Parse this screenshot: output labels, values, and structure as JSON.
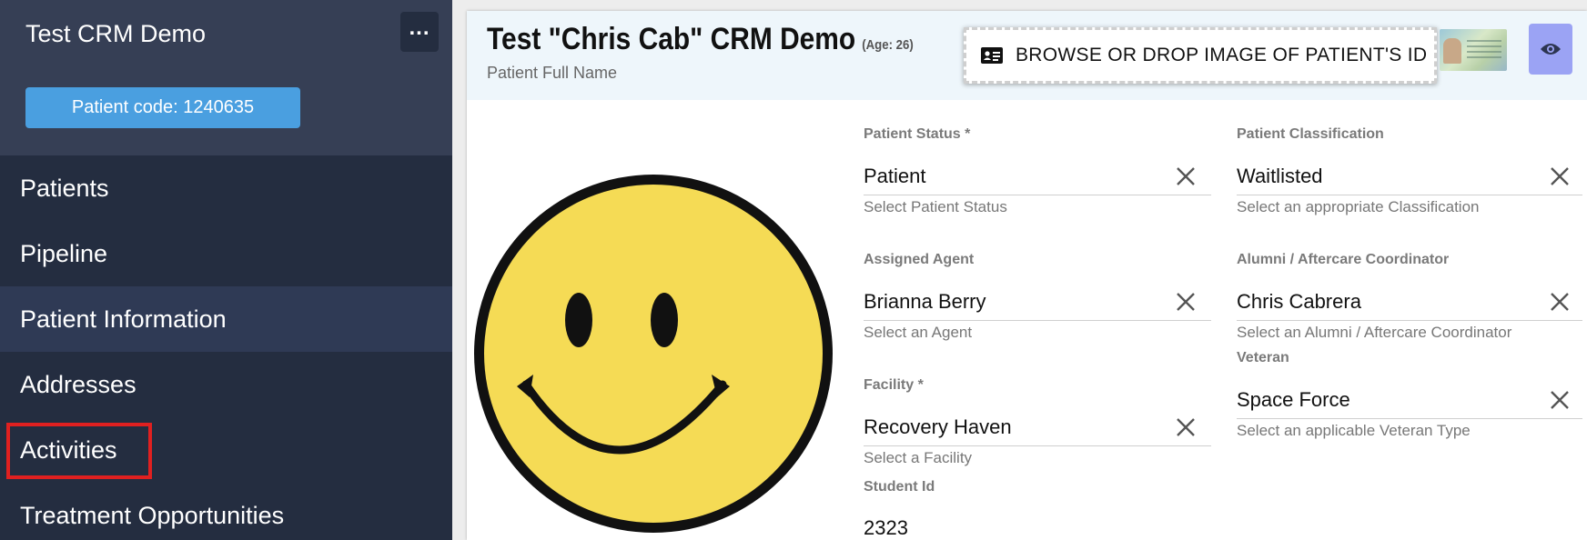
{
  "sidebar": {
    "title": "Test CRM Demo",
    "more_label": "...",
    "patient_code": "Patient code: 1240635",
    "items": [
      {
        "label": "Patients"
      },
      {
        "label": "Pipeline"
      },
      {
        "label": "Patient Information"
      },
      {
        "label": "Addresses"
      },
      {
        "label": "Activities"
      },
      {
        "label": "Treatment Opportunities"
      }
    ]
  },
  "header": {
    "patient_name": "Test \"Chris Cab\" CRM Demo",
    "age": "(Age: 26)",
    "name_label": "Patient Full Name",
    "id_drop_label": "BROWSE OR DROP IMAGE OF PATIENT'S ID"
  },
  "form": {
    "patient_status": {
      "label": "Patient Status *",
      "value": "Patient",
      "hint": "Select Patient Status"
    },
    "patient_classification": {
      "label": "Patient Classification",
      "value": "Waitlisted",
      "hint": "Select an appropriate Classification"
    },
    "assigned_agent": {
      "label": "Assigned Agent",
      "value": "Brianna Berry",
      "hint": "Select an Agent"
    },
    "alumni_coordinator": {
      "label": "Alumni / Aftercare Coordinator",
      "value": "Chris Cabrera",
      "hint": "Select an Alumni / Aftercare Coordinator"
    },
    "veteran": {
      "label": "Veteran",
      "value": "Space Force",
      "hint": "Select an applicable Veteran Type"
    },
    "facility": {
      "label": "Facility *",
      "value": "Recovery Haven",
      "hint": "Select a Facility"
    },
    "student_id": {
      "label": "Student Id",
      "value": "2323"
    }
  },
  "colors": {
    "sidebar_bg": "#242d40",
    "sidebar_header_bg": "#363f55",
    "patient_code_bg": "#4a9fe0",
    "active_nav_bg": "#2f3a55",
    "highlight_border": "#e02020",
    "eye_button_bg": "#9ba3f4",
    "smiley_yellow": "#f5db55"
  },
  "icons": {
    "id_card": "id-card-icon",
    "eye": "eye-icon",
    "clear": "close-icon",
    "avatar": "smiley-face-avatar"
  }
}
